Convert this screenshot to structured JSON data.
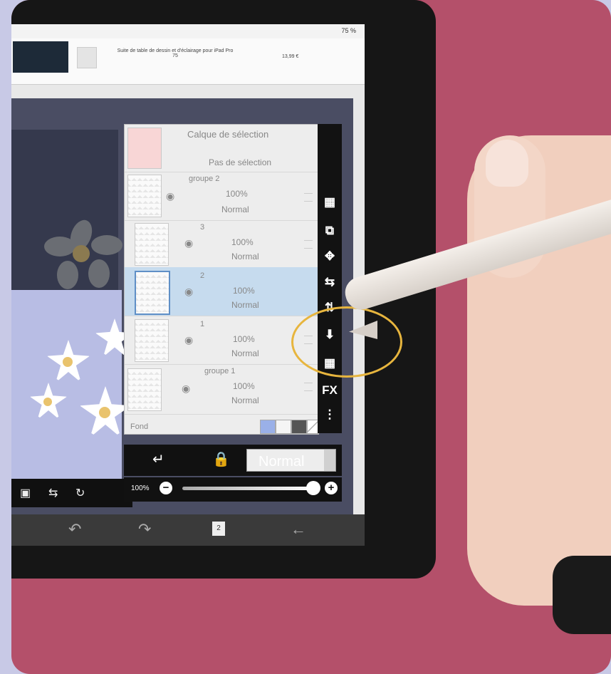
{
  "status_bar": {
    "battery": "75 %"
  },
  "ad": {
    "text": "Suite de table de dessin et d'éclairage pour iPad Pro",
    "sub": "75",
    "price": "13,99 €"
  },
  "layers_panel": {
    "selection_layer": {
      "name": "Calque de sélection",
      "status": "Pas de sélection"
    },
    "items": [
      {
        "name": "groupe 2",
        "opacity": "100%",
        "mode": "Normal"
      },
      {
        "name": "3",
        "opacity": "100%",
        "mode": "Normal"
      },
      {
        "name": "2",
        "opacity": "100%",
        "mode": "Normal"
      },
      {
        "name": "1",
        "opacity": "100%",
        "mode": "Normal"
      },
      {
        "name": "groupe 1",
        "opacity": "100%",
        "mode": "Normal"
      }
    ],
    "background_label": "Fond"
  },
  "side_toolbar": [
    "checker-icon",
    "copy-layer-icon",
    "move-icon",
    "flip-icon",
    "transform-icon",
    "merge-down-icon",
    "delete-icon",
    "FX",
    "more-icon"
  ],
  "side_toolbar_fx": "FX",
  "bottom": {
    "blend_mode": "Normal",
    "opacity_label": "100%"
  },
  "nav": {
    "page_number": "2"
  },
  "colors": {
    "selected_layer": "#c6dbee",
    "highlight": "#e7b53e",
    "panel_bg": "#ededed"
  }
}
